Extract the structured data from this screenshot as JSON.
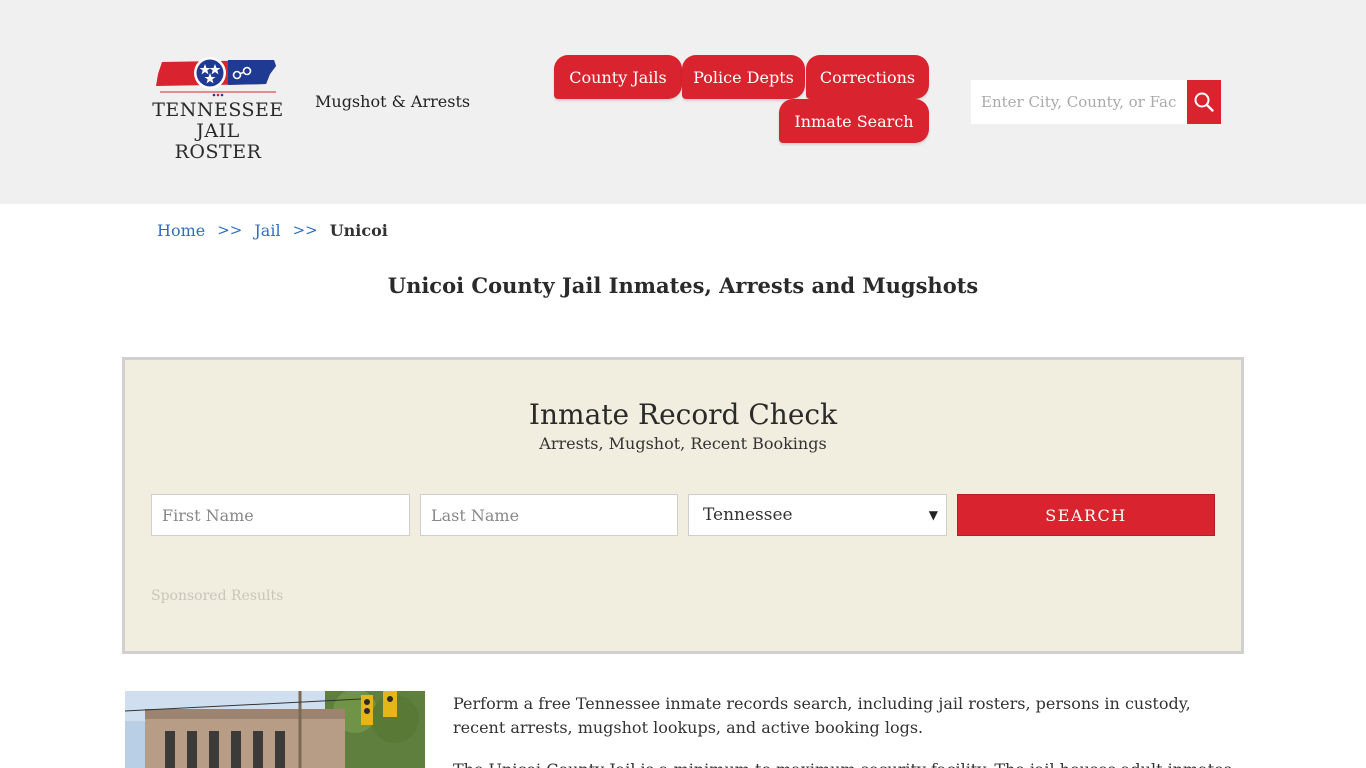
{
  "header": {
    "logo_line1": "TENNESSEE",
    "logo_line2": "JAIL ROSTER",
    "tagline": "Mugshot & Arrests",
    "nav": {
      "county_jails": "County Jails",
      "police_depts": "Police Depts",
      "corrections": "Corrections",
      "inmate_search": "Inmate Search"
    },
    "search": {
      "placeholder": "Enter City, County, or Facility"
    }
  },
  "breadcrumb": {
    "home": "Home",
    "sep": ">>",
    "jail": "Jail",
    "current": "Unicoi"
  },
  "page_title": "Unicoi County Jail Inmates, Arrests and Mugshots",
  "record_check": {
    "title": "Inmate Record Check",
    "subtitle": "Arrests, Mugshot, Recent Bookings",
    "first_name_placeholder": "First Name",
    "last_name_placeholder": "Last Name",
    "state_selected": "Tennessee",
    "search_label": "SEARCH",
    "sponsored": "Sponsored Results"
  },
  "content": {
    "para1": "Perform a free Tennessee inmate records search, including jail rosters, persons in custody, recent arrests, mugshot lookups, and active booking logs.",
    "para2": "The Unicoi County Jail is a minimum to maximum security facility. The jail houses adult inmates and"
  },
  "colors": {
    "accent": "#d9232e",
    "link": "#2f6fbf",
    "panel": "#f1eee0",
    "header_bg": "#f0f0f0"
  }
}
